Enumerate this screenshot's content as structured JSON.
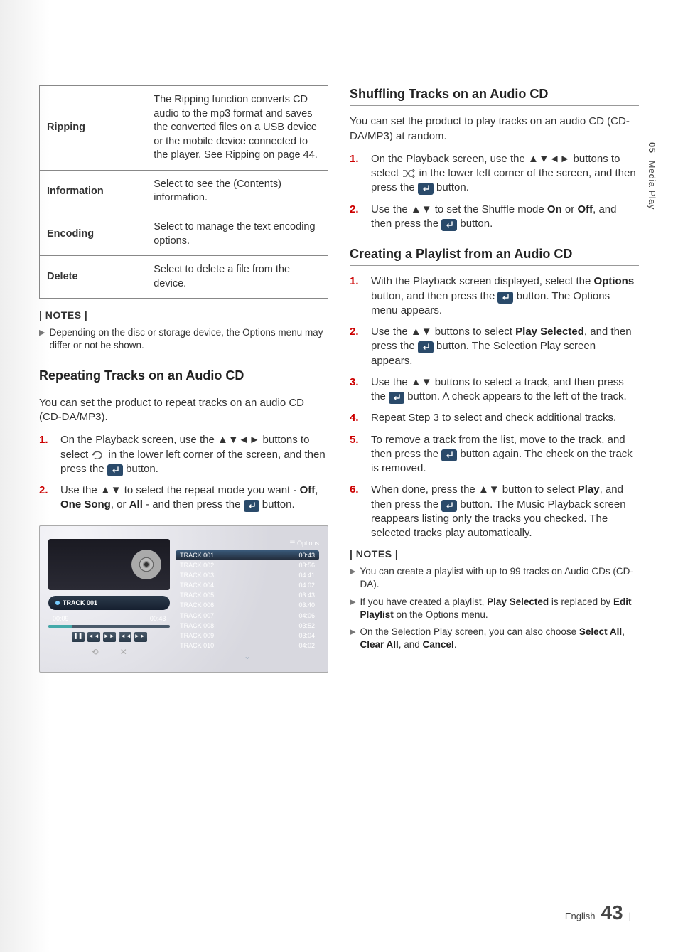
{
  "sidebar": {
    "section_num": "05",
    "section_title": "Media Play"
  },
  "table": {
    "rows": [
      {
        "label": "Ripping",
        "desc": "The Ripping function converts CD audio to the mp3 format and saves the converted files on a USB device or the mobile device connected to the player. See Ripping on page 44."
      },
      {
        "label": "Information",
        "desc": "Select to see the (Contents) information."
      },
      {
        "label": "Encoding",
        "desc": "Select to manage the text encoding options."
      },
      {
        "label": "Delete",
        "desc": "Select to delete a file from the device."
      }
    ]
  },
  "notes_left": {
    "header": "| NOTES |",
    "items": [
      "Depending on the disc or storage device, the Options menu may differ or not be shown."
    ]
  },
  "left": {
    "heading": "Repeating Tracks on an Audio CD",
    "intro": "You can set the product to repeat tracks on an audio CD (CD-DA/MP3).",
    "steps": [
      {
        "pre": "On the Playback screen, use the ",
        "arrows": "▲▼◄►",
        "mid": " buttons to select ",
        "icon": "repeat",
        "post": " in the lower left corner of the screen, and then press the ",
        "enter": true,
        "tail": " button."
      },
      {
        "pre": "Use the ",
        "arrows": "▲▼",
        "mid": " to select the repeat mode you want - ",
        "bold1": "Off",
        "sep1": ", ",
        "bold2": "One Song",
        "sep2": ", or ",
        "bold3": "All",
        "post2": " - and then press the ",
        "enter": true,
        "tail": " button."
      }
    ]
  },
  "player": {
    "options_label": "Options",
    "now_playing": "TRACK 001",
    "time_elapsed": "00:09",
    "time_total": "00:43",
    "tracks": [
      {
        "name": "TRACK 001",
        "dur": "00:43"
      },
      {
        "name": "TRACK 002",
        "dur": "03:56"
      },
      {
        "name": "TRACK 003",
        "dur": "04:41"
      },
      {
        "name": "TRACK 004",
        "dur": "04:02"
      },
      {
        "name": "TRACK 005",
        "dur": "03:43"
      },
      {
        "name": "TRACK 006",
        "dur": "03:40"
      },
      {
        "name": "TRACK 007",
        "dur": "04:06"
      },
      {
        "name": "TRACK 008",
        "dur": "03:52"
      },
      {
        "name": "TRACK 009",
        "dur": "03:04"
      },
      {
        "name": "TRACK 010",
        "dur": "04:02"
      }
    ]
  },
  "right": {
    "sec1": {
      "heading": "Shuffling Tracks on an Audio CD",
      "intro": "You can set the product to play tracks on an audio CD (CD-DA/MP3) at random.",
      "steps": [
        {
          "pre": "On the Playback screen, use the ",
          "arrows": "▲▼◄►",
          "mid": " buttons to select ",
          "icon": "shuffle",
          "post": " in the lower left corner of the screen, and then press the ",
          "enter": true,
          "tail": " button."
        },
        {
          "pre": "Use the ",
          "arrows": "▲▼",
          "mid": " to set the Shuffle mode ",
          "bold1": "On",
          "sep1": " or ",
          "bold2": "Off",
          "post2": ", and then press the ",
          "enter": true,
          "tail": " button."
        }
      ]
    },
    "sec2": {
      "heading": "Creating a Playlist from an Audio CD",
      "steps": [
        {
          "text_a": "With the Playback screen displayed, select the ",
          "bold1": "Options",
          "text_b": " button, and then press the ",
          "enter": true,
          "text_c": " button. The Options menu appears."
        },
        {
          "text_a": "Use the ",
          "arrows": "▲▼",
          "text_b": " buttons to select ",
          "bold1": "Play Selected",
          "text_c": ", and then press the ",
          "enter": true,
          "text_d": " button. The Selection Play screen appears."
        },
        {
          "text_a": "Use the ",
          "arrows": "▲▼",
          "text_b": " buttons to select a track, and then press the ",
          "enter": true,
          "text_c": " button. A check appears to the left of the track."
        },
        {
          "text_a": "Repeat Step 3 to select and check additional tracks."
        },
        {
          "text_a": "To remove a track from the list, move to the track, and then press the ",
          "enter": true,
          "text_b": " button again. The check on the track is removed."
        },
        {
          "text_a": "When done, press the ",
          "arrows": "▲▼",
          "text_b": " button to select ",
          "bold1": "Play",
          "text_c": ", and then press the ",
          "enter": true,
          "text_d": " button. The Music Playback screen reappears listing only the tracks you checked. The selected tracks play automatically."
        }
      ]
    },
    "notes": {
      "header": "| NOTES |",
      "items": [
        {
          "a": "You can create a playlist with up to 99 tracks on Audio CDs (CD-DA)."
        },
        {
          "a": "If you have created a playlist, ",
          "b": "Play Selected",
          "c": " is replaced by ",
          "d": "Edit Playlist",
          "e": " on the Options menu."
        },
        {
          "a": "On the Selection Play screen, you can also choose ",
          "b": "Select All",
          "c": ", ",
          "d": "Clear All",
          "e": ", and ",
          "f": "Cancel",
          "g": "."
        }
      ]
    }
  },
  "footer": {
    "lang": "English",
    "page": "43"
  }
}
